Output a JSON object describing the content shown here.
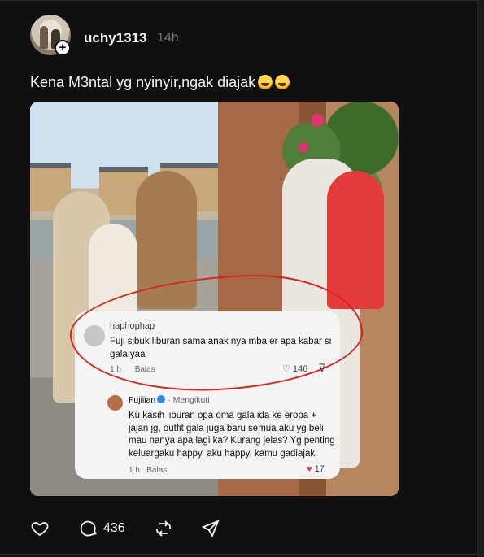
{
  "post": {
    "username": "uchy1313",
    "time": "14h",
    "caption": "Kena M3ntal yg nyinyir,ngak diajak",
    "follow_icon": "plus-icon"
  },
  "embedded_screenshot": {
    "comment": {
      "username": "haphophap",
      "text": "Fuji sibuk liburan sama anak nya mba er apa kabar si gala yaa",
      "time": "1 h",
      "reply_label": "Balas",
      "likes": "146"
    },
    "reply": {
      "username": "Fujiiian",
      "follow_status": "Mengikuti",
      "text": "Ku kasih liburan opa oma gala ida ke eropa + jajan jg, outfit gala juga baru semua aku yg beli, mau nanya apa lagi ka? Kurang jelas? Yg penting keluargaku happy, aku happy, kamu gadiajak.",
      "time": "1 h",
      "reply_label": "Balas",
      "likes": "17"
    }
  },
  "actions": {
    "like_icon": "heart-icon",
    "reply_icon": "comment-icon",
    "reply_count": "436",
    "repost_icon": "repost-icon",
    "share_icon": "send-icon"
  },
  "colors": {
    "background": "#101010",
    "text": "#f3f5f7",
    "muted": "#777777",
    "highlight_ring": "#d8261c"
  }
}
